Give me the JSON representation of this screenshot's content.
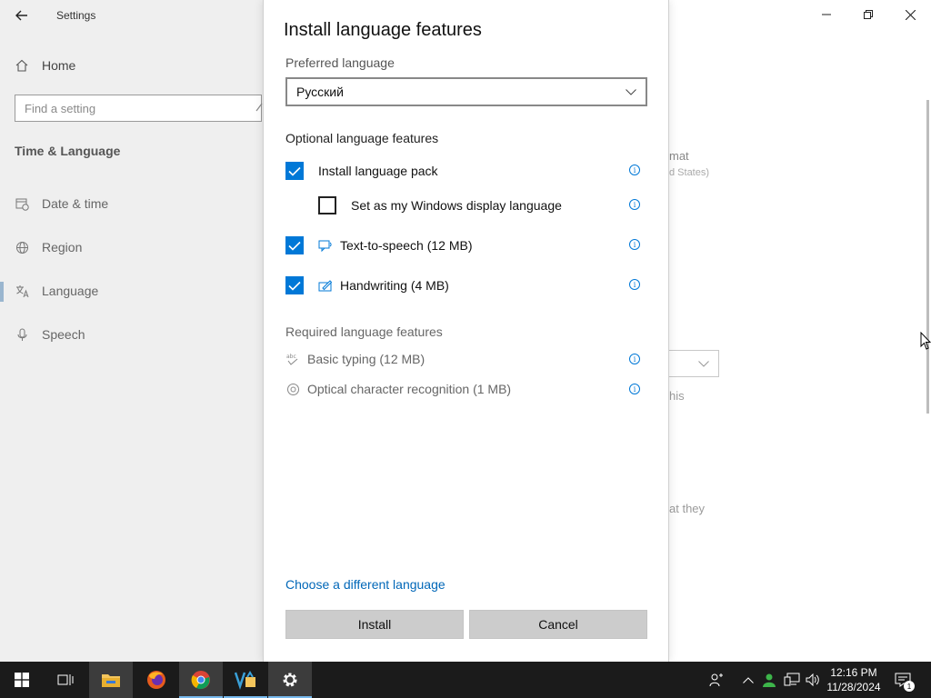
{
  "settings": {
    "app_title": "Settings",
    "home_label": "Home",
    "search_placeholder": "Find a setting",
    "section_title": "Time & Language",
    "nav": [
      {
        "label": "Date & time",
        "icon": "calendar-clock-icon"
      },
      {
        "label": "Region",
        "icon": "globe-icon"
      },
      {
        "label": "Language",
        "icon": "language-icon",
        "selected": true
      },
      {
        "label": "Speech",
        "icon": "microphone-icon"
      }
    ],
    "background_text": {
      "format_fragment": "mat",
      "region_fragment": "d States)",
      "this_fragment": "his",
      "they_fragment": "at they"
    }
  },
  "dialog": {
    "title": "Install language features",
    "preferred_label": "Preferred language",
    "preferred_value": "Русский",
    "optional_label": "Optional language features",
    "optional_features": [
      {
        "label": "Install language pack",
        "checked": true
      },
      {
        "label": "Set as my Windows display language",
        "checked": false
      },
      {
        "label": "Text-to-speech (12 MB)",
        "checked": true,
        "icon": "speech-icon"
      },
      {
        "label": "Handwriting (4 MB)",
        "checked": true,
        "icon": "handwriting-icon"
      }
    ],
    "required_label": "Required language features",
    "required_features": [
      {
        "label": "Basic typing (12 MB)",
        "icon": "typing-icon"
      },
      {
        "label": "Optical character recognition (1 MB)",
        "icon": "ocr-icon"
      }
    ],
    "link_label": "Choose a different language",
    "install_label": "Install",
    "cancel_label": "Cancel"
  },
  "taskbar": {
    "time": "12:16 PM",
    "date": "11/28/2024",
    "notification_count": "1",
    "accent": "#76b9ed"
  },
  "colors": {
    "accent": "#0078d7",
    "link": "#0067b8"
  }
}
